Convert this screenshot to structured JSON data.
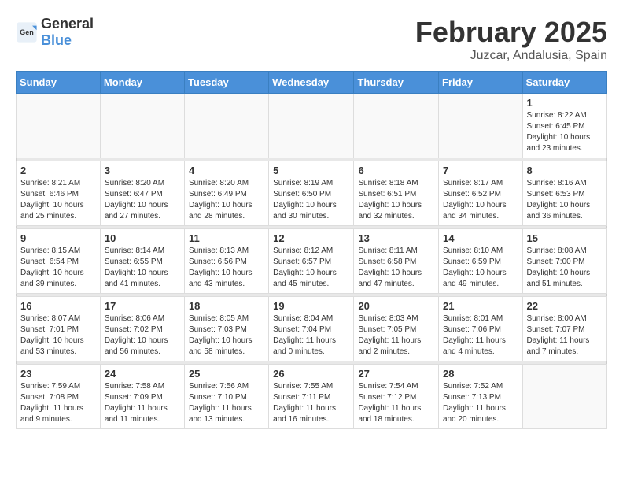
{
  "header": {
    "logo_general": "General",
    "logo_blue": "Blue",
    "title": "February 2025",
    "subtitle": "Juzcar, Andalusia, Spain"
  },
  "weekdays": [
    "Sunday",
    "Monday",
    "Tuesday",
    "Wednesday",
    "Thursday",
    "Friday",
    "Saturday"
  ],
  "weeks": [
    [
      {
        "day": "",
        "info": ""
      },
      {
        "day": "",
        "info": ""
      },
      {
        "day": "",
        "info": ""
      },
      {
        "day": "",
        "info": ""
      },
      {
        "day": "",
        "info": ""
      },
      {
        "day": "",
        "info": ""
      },
      {
        "day": "1",
        "info": "Sunrise: 8:22 AM\nSunset: 6:45 PM\nDaylight: 10 hours\nand 23 minutes."
      }
    ],
    [
      {
        "day": "2",
        "info": "Sunrise: 8:21 AM\nSunset: 6:46 PM\nDaylight: 10 hours\nand 25 minutes."
      },
      {
        "day": "3",
        "info": "Sunrise: 8:20 AM\nSunset: 6:47 PM\nDaylight: 10 hours\nand 27 minutes."
      },
      {
        "day": "4",
        "info": "Sunrise: 8:20 AM\nSunset: 6:49 PM\nDaylight: 10 hours\nand 28 minutes."
      },
      {
        "day": "5",
        "info": "Sunrise: 8:19 AM\nSunset: 6:50 PM\nDaylight: 10 hours\nand 30 minutes."
      },
      {
        "day": "6",
        "info": "Sunrise: 8:18 AM\nSunset: 6:51 PM\nDaylight: 10 hours\nand 32 minutes."
      },
      {
        "day": "7",
        "info": "Sunrise: 8:17 AM\nSunset: 6:52 PM\nDaylight: 10 hours\nand 34 minutes."
      },
      {
        "day": "8",
        "info": "Sunrise: 8:16 AM\nSunset: 6:53 PM\nDaylight: 10 hours\nand 36 minutes."
      }
    ],
    [
      {
        "day": "9",
        "info": "Sunrise: 8:15 AM\nSunset: 6:54 PM\nDaylight: 10 hours\nand 39 minutes."
      },
      {
        "day": "10",
        "info": "Sunrise: 8:14 AM\nSunset: 6:55 PM\nDaylight: 10 hours\nand 41 minutes."
      },
      {
        "day": "11",
        "info": "Sunrise: 8:13 AM\nSunset: 6:56 PM\nDaylight: 10 hours\nand 43 minutes."
      },
      {
        "day": "12",
        "info": "Sunrise: 8:12 AM\nSunset: 6:57 PM\nDaylight: 10 hours\nand 45 minutes."
      },
      {
        "day": "13",
        "info": "Sunrise: 8:11 AM\nSunset: 6:58 PM\nDaylight: 10 hours\nand 47 minutes."
      },
      {
        "day": "14",
        "info": "Sunrise: 8:10 AM\nSunset: 6:59 PM\nDaylight: 10 hours\nand 49 minutes."
      },
      {
        "day": "15",
        "info": "Sunrise: 8:08 AM\nSunset: 7:00 PM\nDaylight: 10 hours\nand 51 minutes."
      }
    ],
    [
      {
        "day": "16",
        "info": "Sunrise: 8:07 AM\nSunset: 7:01 PM\nDaylight: 10 hours\nand 53 minutes."
      },
      {
        "day": "17",
        "info": "Sunrise: 8:06 AM\nSunset: 7:02 PM\nDaylight: 10 hours\nand 56 minutes."
      },
      {
        "day": "18",
        "info": "Sunrise: 8:05 AM\nSunset: 7:03 PM\nDaylight: 10 hours\nand 58 minutes."
      },
      {
        "day": "19",
        "info": "Sunrise: 8:04 AM\nSunset: 7:04 PM\nDaylight: 11 hours\nand 0 minutes."
      },
      {
        "day": "20",
        "info": "Sunrise: 8:03 AM\nSunset: 7:05 PM\nDaylight: 11 hours\nand 2 minutes."
      },
      {
        "day": "21",
        "info": "Sunrise: 8:01 AM\nSunset: 7:06 PM\nDaylight: 11 hours\nand 4 minutes."
      },
      {
        "day": "22",
        "info": "Sunrise: 8:00 AM\nSunset: 7:07 PM\nDaylight: 11 hours\nand 7 minutes."
      }
    ],
    [
      {
        "day": "23",
        "info": "Sunrise: 7:59 AM\nSunset: 7:08 PM\nDaylight: 11 hours\nand 9 minutes."
      },
      {
        "day": "24",
        "info": "Sunrise: 7:58 AM\nSunset: 7:09 PM\nDaylight: 11 hours\nand 11 minutes."
      },
      {
        "day": "25",
        "info": "Sunrise: 7:56 AM\nSunset: 7:10 PM\nDaylight: 11 hours\nand 13 minutes."
      },
      {
        "day": "26",
        "info": "Sunrise: 7:55 AM\nSunset: 7:11 PM\nDaylight: 11 hours\nand 16 minutes."
      },
      {
        "day": "27",
        "info": "Sunrise: 7:54 AM\nSunset: 7:12 PM\nDaylight: 11 hours\nand 18 minutes."
      },
      {
        "day": "28",
        "info": "Sunrise: 7:52 AM\nSunset: 7:13 PM\nDaylight: 11 hours\nand 20 minutes."
      },
      {
        "day": "",
        "info": ""
      }
    ]
  ]
}
